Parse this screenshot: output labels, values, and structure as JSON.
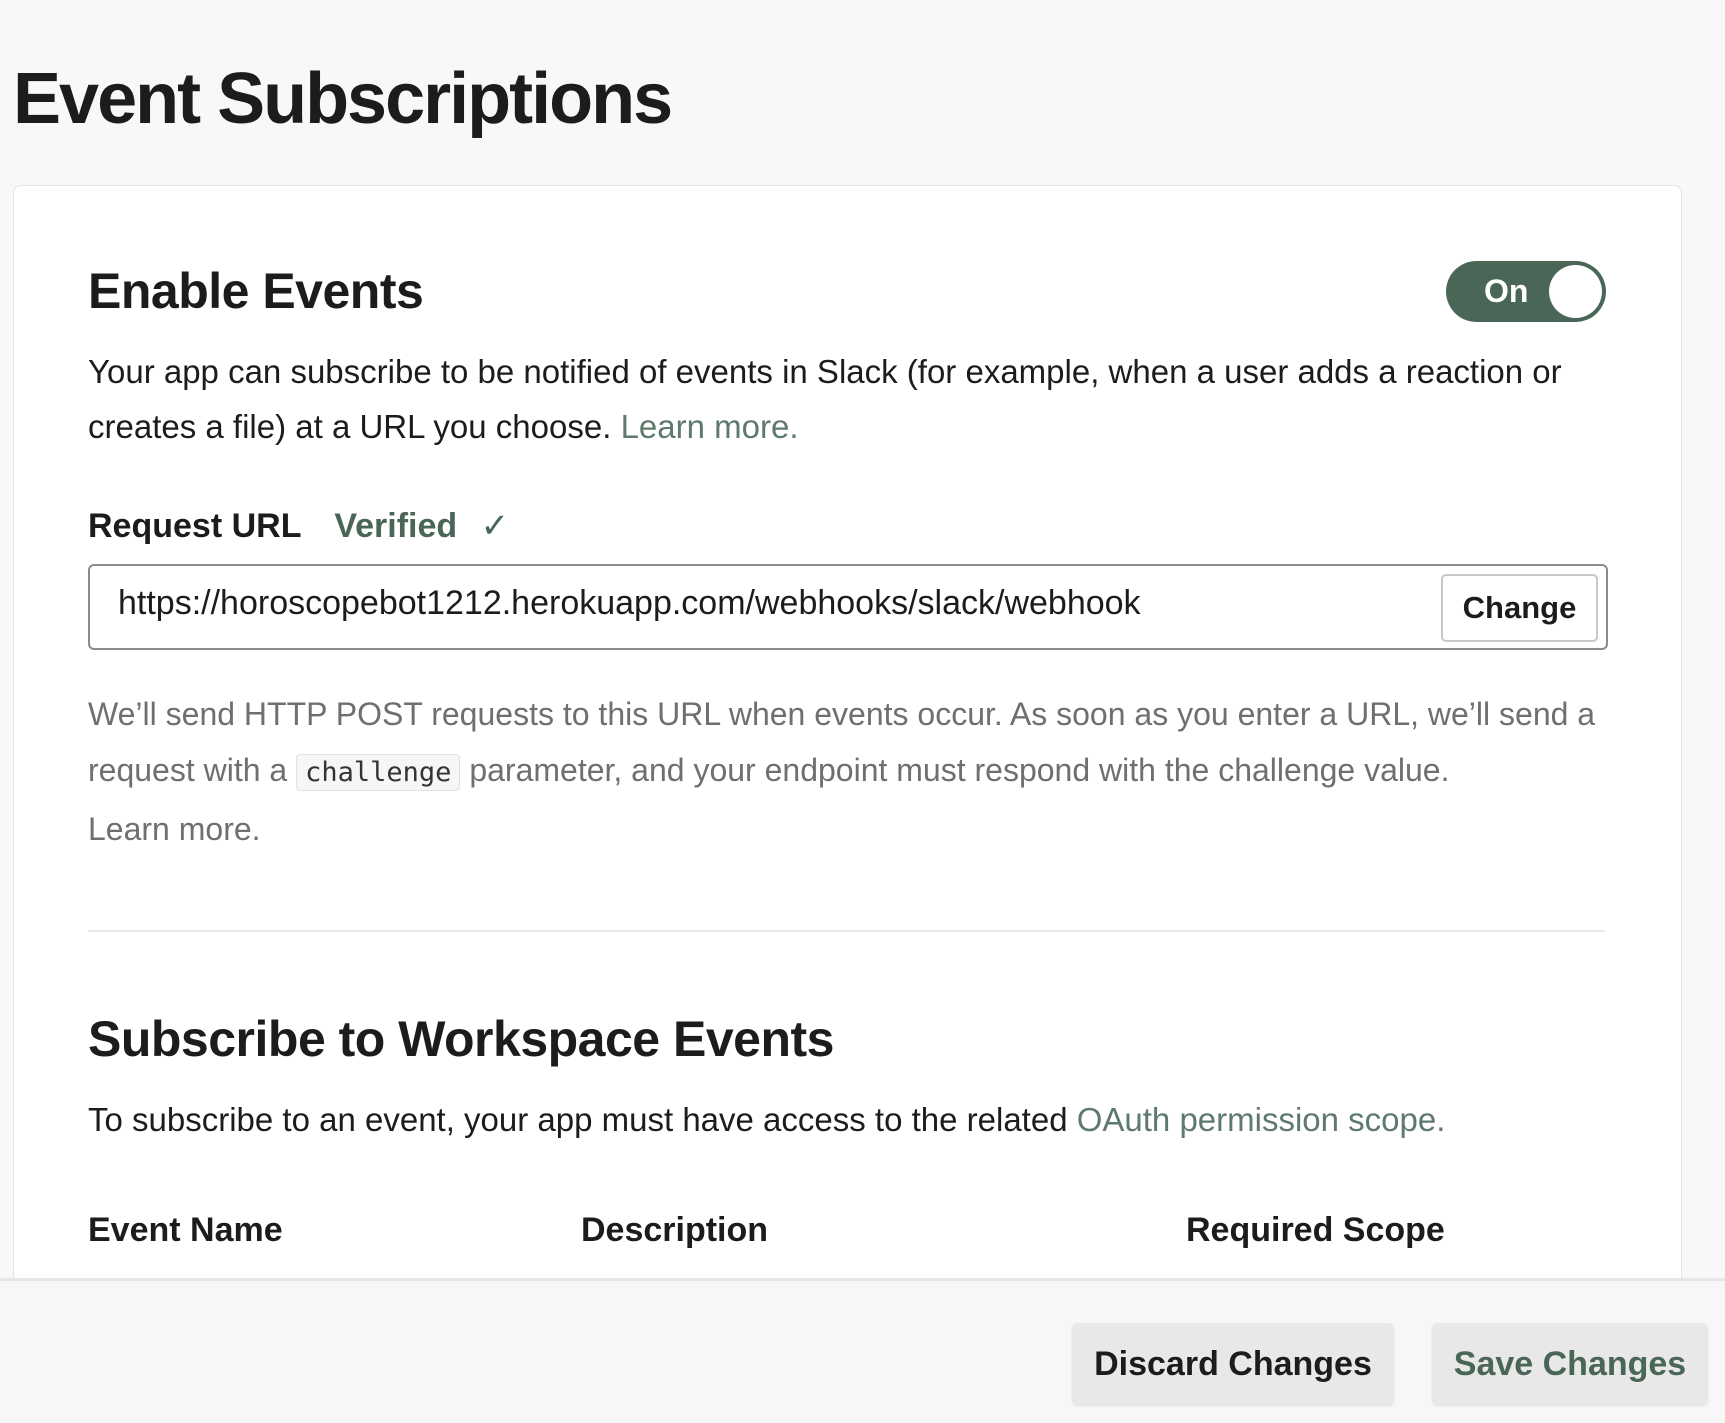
{
  "page_title": "Event Subscriptions",
  "enable_events": {
    "heading": "Enable Events",
    "toggle_label": "On",
    "toggle_on": true,
    "description": "Your app can subscribe to be notified of events in Slack (for example, when a user adds a reaction or creates a file) at a URL you choose.",
    "learn_more": "Learn more."
  },
  "request_url": {
    "label": "Request URL",
    "status": "Verified",
    "status_icon": "checkmark-icon",
    "value": "https://horoscopebot1212.herokuapp.com/webhooks/slack/webhook",
    "change_label": "Change",
    "help_before": "We’ll send HTTP POST requests to this URL when events occur. As soon as you enter a URL, we’ll send a request with a",
    "help_code": "challenge",
    "help_after": "parameter, and your endpoint must respond with the challenge value.",
    "learn_more": "Learn more."
  },
  "workspace_events": {
    "heading": "Subscribe to Workspace Events",
    "description": "To subscribe to an event, your app must have access to the related",
    "scope_link": "OAuth permission scope.",
    "columns": [
      "Event Name",
      "Description",
      "Required Scope"
    ]
  },
  "footer": {
    "discard_label": "Discard Changes",
    "save_label": "Save Changes"
  },
  "colors": {
    "accent": "#4a6657",
    "link": "#5e7a6c"
  }
}
